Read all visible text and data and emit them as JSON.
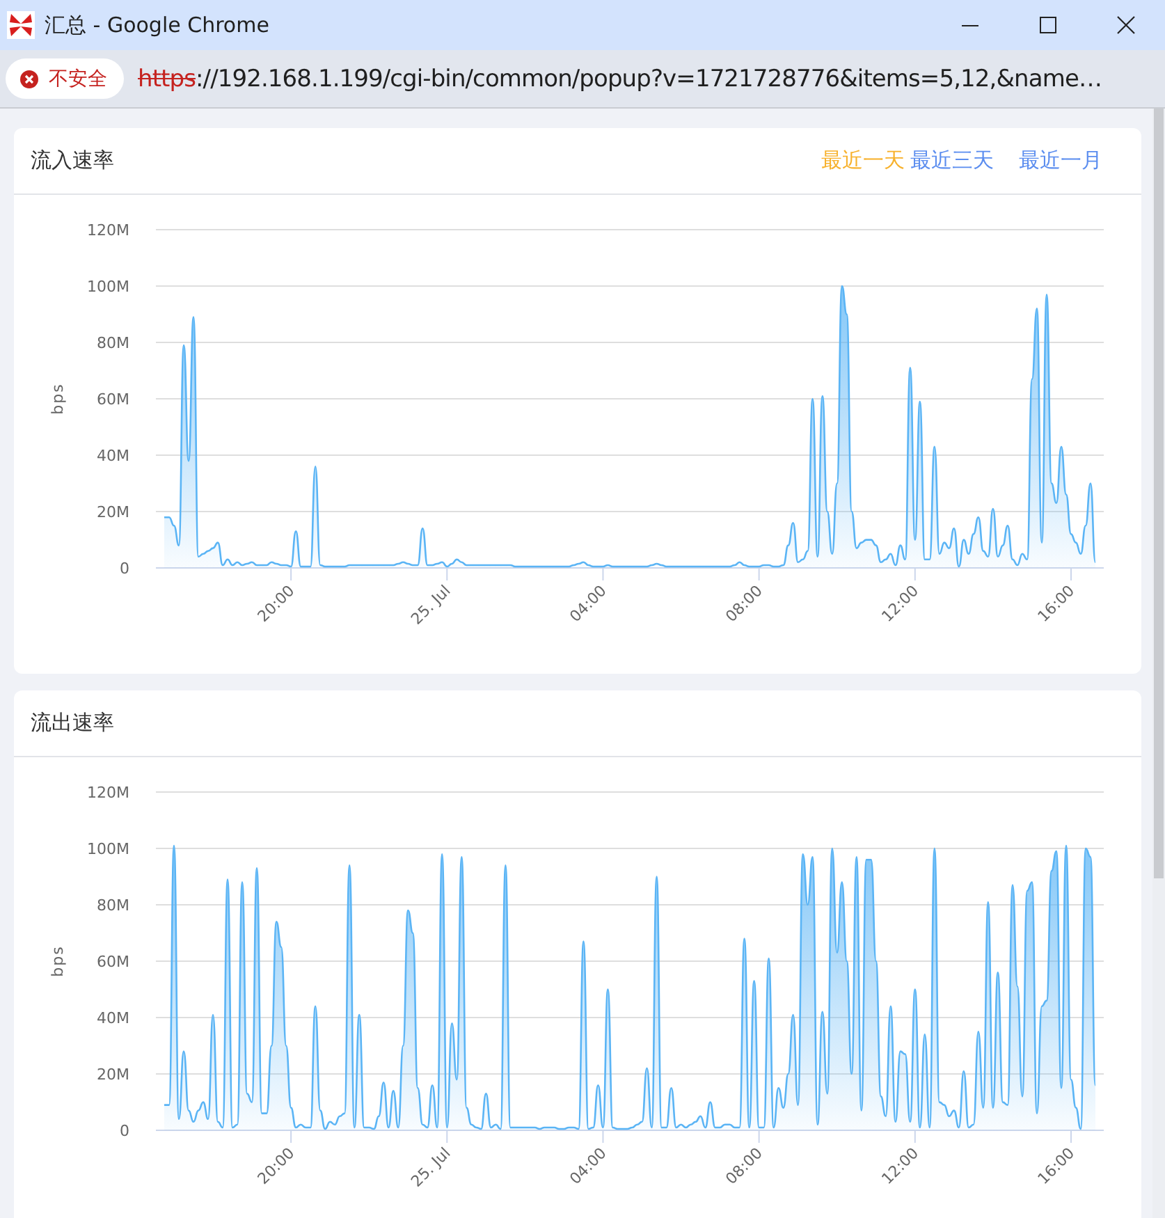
{
  "window": {
    "title": "汇总 - Google Chrome"
  },
  "address_bar": {
    "security_label": "不安全",
    "url_scheme": "https",
    "url_rest": "://192.168.1.199/cgi-bin/common/popup?v=1721728776&items=5,12,&name…"
  },
  "cards": [
    {
      "title": "流入速率",
      "ranges": [
        {
          "label": "最近一天",
          "selected": true
        },
        {
          "label": "最近三天",
          "selected": false
        },
        {
          "label": "最近一月",
          "selected": false
        }
      ],
      "chart_data": {
        "type": "area",
        "ylabel": "bps",
        "grid": true,
        "categories": [
          null,
          null,
          null,
          null,
          null,
          null,
          null,
          null,
          null,
          null,
          null,
          null,
          null,
          null,
          null,
          null,
          null,
          null,
          null,
          null,
          null,
          null,
          null,
          null,
          null,
          null,
          "20:00",
          null,
          null,
          null,
          null,
          null,
          null,
          null,
          null,
          null,
          null,
          null,
          null,
          null,
          null,
          null,
          null,
          null,
          null,
          null,
          null,
          null,
          null,
          null,
          null,
          null,
          null,
          null,
          null,
          null,
          null,
          null,
          "25. Jul",
          null,
          null,
          null,
          null,
          null,
          null,
          null,
          null,
          null,
          null,
          null,
          null,
          null,
          null,
          null,
          null,
          null,
          null,
          null,
          null,
          null,
          null,
          null,
          null,
          null,
          null,
          null,
          null,
          null,
          null,
          null,
          "04:00",
          null,
          null,
          null,
          null,
          null,
          null,
          null,
          null,
          null,
          null,
          null,
          null,
          null,
          null,
          null,
          null,
          null,
          null,
          null,
          null,
          null,
          null,
          null,
          null,
          null,
          null,
          null,
          null,
          null,
          null,
          null,
          "08:00",
          null,
          null,
          null,
          null,
          null,
          null,
          null,
          null,
          null,
          null,
          null,
          null,
          null,
          null,
          null,
          null,
          null,
          null,
          null,
          null,
          null,
          null,
          null,
          null,
          null,
          null,
          null,
          null,
          null,
          null,
          null,
          "12:00",
          null,
          null,
          null,
          null,
          null,
          null,
          null,
          null,
          null,
          null,
          null,
          null,
          null,
          null,
          null,
          null,
          null,
          null,
          null,
          null,
          null,
          null,
          null,
          null,
          null,
          null,
          null,
          null,
          null,
          null,
          null,
          "16:00",
          null,
          null,
          null,
          null,
          null
        ],
        "series": [
          {
            "color": "#5ab4f5",
            "values": [
              18,
              18,
              15,
              8,
              79,
              38,
              89,
              4,
              5,
              6,
              7,
              9,
              1,
              3,
              1,
              2,
              1,
              1.5,
              2,
              1,
              1,
              1,
              2,
              1.5,
              1,
              1,
              0.5,
              13,
              0.5,
              0.5,
              0.5,
              36,
              1,
              0.5,
              0.5,
              0.5,
              0.5,
              0.5,
              1,
              1,
              1,
              1,
              1,
              1,
              1,
              1,
              1,
              1,
              1.5,
              2,
              1.5,
              1,
              1,
              14,
              1,
              1,
              1.5,
              2,
              0.5,
              1.5,
              3,
              2,
              1,
              1,
              1,
              1,
              1,
              1,
              1,
              1,
              1,
              1,
              0.5,
              0.5,
              0.5,
              0.5,
              0.5,
              0.5,
              0.5,
              0.5,
              0.5,
              0.5,
              0.5,
              0.5,
              1,
              1.5,
              2,
              1,
              0.5,
              0.5,
              0.5,
              1,
              0.5,
              0.5,
              0.5,
              0.5,
              0.5,
              0.5,
              0.5,
              0.5,
              1,
              1.5,
              1,
              0.5,
              0.5,
              0.5,
              0.5,
              0.5,
              0.5,
              0.5,
              0.5,
              0.5,
              0.5,
              0.5,
              0.5,
              0.5,
              0.5,
              1,
              2,
              1,
              0.5,
              0.5,
              0.5,
              1,
              1,
              0.5,
              0.5,
              1,
              8,
              16,
              2,
              3,
              6,
              60,
              4,
              61,
              20,
              5,
              30,
              100,
              90,
              20,
              7,
              9,
              10,
              10,
              8,
              2,
              3,
              5,
              1,
              8,
              3,
              71,
              10,
              59,
              3,
              3,
              43,
              5,
              9,
              7,
              14,
              0.5,
              10,
              5,
              12,
              18,
              6,
              4,
              21,
              4,
              8,
              15,
              3,
              1,
              5,
              3,
              67,
              92,
              9,
              97,
              30,
              23,
              43,
              26,
              12,
              9,
              5,
              15,
              30,
              2
            ]
          }
        ],
        "ylim": [
          0,
          120
        ],
        "yticks": [
          {
            "value": 0,
            "label": "0"
          },
          {
            "value": 20,
            "label": "20M"
          },
          {
            "value": 40,
            "label": "40M"
          },
          {
            "value": 60,
            "label": "60M"
          },
          {
            "value": 80,
            "label": "80M"
          },
          {
            "value": 100,
            "label": "100M"
          },
          {
            "value": 120,
            "label": "120M"
          }
        ]
      }
    },
    {
      "title": "流出速率",
      "chart_data": {
        "type": "area",
        "ylabel": "bps",
        "grid": true,
        "categories": [
          null,
          null,
          null,
          null,
          null,
          null,
          null,
          null,
          null,
          null,
          null,
          null,
          null,
          null,
          null,
          null,
          null,
          null,
          null,
          null,
          null,
          null,
          null,
          null,
          null,
          null,
          "20:00",
          null,
          null,
          null,
          null,
          null,
          null,
          null,
          null,
          null,
          null,
          null,
          null,
          null,
          null,
          null,
          null,
          null,
          null,
          null,
          null,
          null,
          null,
          null,
          null,
          null,
          null,
          null,
          null,
          null,
          null,
          null,
          "25. Jul",
          null,
          null,
          null,
          null,
          null,
          null,
          null,
          null,
          null,
          null,
          null,
          null,
          null,
          null,
          null,
          null,
          null,
          null,
          null,
          null,
          null,
          null,
          null,
          null,
          null,
          null,
          null,
          null,
          null,
          null,
          null,
          "04:00",
          null,
          null,
          null,
          null,
          null,
          null,
          null,
          null,
          null,
          null,
          null,
          null,
          null,
          null,
          null,
          null,
          null,
          null,
          null,
          null,
          null,
          null,
          null,
          null,
          null,
          null,
          null,
          null,
          null,
          null,
          null,
          "08:00",
          null,
          null,
          null,
          null,
          null,
          null,
          null,
          null,
          null,
          null,
          null,
          null,
          null,
          null,
          null,
          null,
          null,
          null,
          null,
          null,
          null,
          null,
          null,
          null,
          null,
          null,
          null,
          null,
          null,
          null,
          null,
          "12:00",
          null,
          null,
          null,
          null,
          null,
          null,
          null,
          null,
          null,
          null,
          null,
          null,
          null,
          null,
          null,
          null,
          null,
          null,
          null,
          null,
          null,
          null,
          null,
          null,
          null,
          null,
          null,
          null,
          null,
          null,
          null,
          "16:00",
          null,
          null,
          null,
          null,
          null
        ],
        "series": [
          {
            "color": "#5ab4f5",
            "values": [
              9,
              9,
              101,
              4,
              28,
              7,
              3,
              7,
              10,
              4,
              41,
              3,
              1,
              89,
              1,
              2,
              88,
              13,
              10,
              93,
              6,
              6,
              30,
              74,
              65,
              30,
              8,
              1,
              2,
              1,
              1,
              44,
              7,
              0.5,
              3,
              2,
              5,
              6,
              94,
              1,
              41,
              1,
              1,
              0.5,
              5,
              17,
              1,
              14,
              1,
              30,
              78,
              70,
              15,
              2,
              1,
              16,
              1,
              98,
              1,
              38,
              18,
              97,
              8,
              2,
              1,
              0.5,
              13,
              1,
              2,
              0.5,
              94,
              1,
              1,
              1,
              1,
              1,
              1,
              0.5,
              1,
              1,
              1,
              0.5,
              0.5,
              1,
              1,
              0.5,
              67,
              0.5,
              1,
              16,
              1,
              50,
              1,
              0.5,
              0.5,
              0.5,
              1,
              2,
              3,
              22,
              1,
              90,
              1,
              1,
              15,
              1,
              2,
              1,
              2,
              3,
              5,
              1,
              10,
              1,
              1,
              2,
              2,
              1,
              1,
              68,
              1,
              53,
              1,
              1,
              61,
              1,
              15,
              8,
              20,
              41,
              9,
              98,
              80,
              97,
              2,
              42,
              13,
              100,
              63,
              88,
              60,
              20,
              97,
              7,
              96,
              96,
              60,
              12,
              5,
              44,
              3,
              28,
              27,
              3,
              50,
              1,
              34,
              1,
              100,
              10,
              9,
              5,
              7,
              1,
              21,
              1,
              2,
              35,
              8,
              81,
              8,
              56,
              10,
              9,
              87,
              51,
              12,
              85,
              88,
              6,
              44,
              46,
              92,
              99,
              15,
              101,
              18,
              8,
              0.5,
              100,
              97,
              16
            ]
          }
        ],
        "ylim": [
          0,
          120
        ],
        "yticks": [
          {
            "value": 0,
            "label": "0"
          },
          {
            "value": 20,
            "label": "20M"
          },
          {
            "value": 40,
            "label": "40M"
          },
          {
            "value": 60,
            "label": "60M"
          },
          {
            "value": 80,
            "label": "80M"
          },
          {
            "value": 100,
            "label": "100M"
          },
          {
            "value": 120,
            "label": "120M"
          }
        ]
      }
    }
  ]
}
